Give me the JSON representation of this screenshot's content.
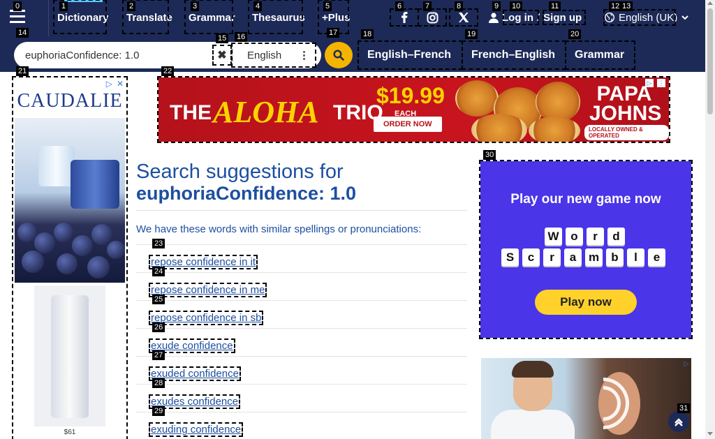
{
  "header": {
    "nav": [
      {
        "label": "Dictionary",
        "hint": "1"
      },
      {
        "label": "Translate",
        "hint": "2"
      },
      {
        "label": "Grammar",
        "hint": "3"
      },
      {
        "label": "Thesaurus",
        "hint": "4"
      },
      {
        "label": "+Plus",
        "hint": "5"
      }
    ],
    "menu_hint": "0",
    "social": [
      {
        "name": "facebook",
        "hint": "6"
      },
      {
        "name": "instagram",
        "hint": "7"
      },
      {
        "name": "x-twitter",
        "hint": "8"
      }
    ],
    "login": {
      "hint": "9",
      "login_label": "Log in",
      "separator": "/",
      "signup_label": "Sign up",
      "signup_hint": "10",
      "signup_hint2": "11"
    },
    "language": {
      "label": "English (UK)",
      "hint_a": "12",
      "hint_b": "13"
    }
  },
  "search": {
    "value": "euphoriaConfidence: 1.0",
    "hint": "14",
    "clear_hint": "15",
    "dictionary_select": "English",
    "select_hint": "16",
    "submit_hint": "17"
  },
  "dict_links": [
    {
      "label": "English–French",
      "hint": "18"
    },
    {
      "label": "French–English",
      "hint": "19"
    },
    {
      "label": "Grammar",
      "hint": "20"
    }
  ],
  "ads": {
    "left": {
      "hint": "21",
      "brand": "CAUDALIE",
      "price": "$61"
    },
    "banner": {
      "hint": "22",
      "the": "THE",
      "aloha": "ALOHA",
      "trio": "TRIO",
      "price": "$19.99",
      "each": "EACH",
      "order": "ORDER NOW",
      "brand_line1": "PAPA",
      "brand_line2": "JOHNS",
      "local": "LOCALLY OWNED & OPERATED"
    },
    "game": {
      "hint": "30",
      "title": "Play our new game now",
      "row1": [
        "W",
        "o",
        "r",
        "d"
      ],
      "row2": [
        "S",
        "c",
        "r",
        "a",
        "m",
        "b",
        "l",
        "e"
      ],
      "button": "Play now"
    }
  },
  "main": {
    "title_prefix": "Search suggestions for",
    "title_query": "euphoriaConfidence: 1.0",
    "intro": "We have these words with similar spellings or pronunciations:",
    "suggestions": [
      {
        "text": "repose confidence in it",
        "hint": "23"
      },
      {
        "text": "repose confidence in me",
        "hint": "24"
      },
      {
        "text": "repose confidence in sb",
        "hint": "25"
      },
      {
        "text": "exude confidence",
        "hint": "26"
      },
      {
        "text": "exuded confidence",
        "hint": "27"
      },
      {
        "text": "exudes confidence",
        "hint": "28"
      },
      {
        "text": "exuding confidence",
        "hint": "29"
      }
    ]
  },
  "scroll_top_hint": "31",
  "colors": {
    "header_bg": "#1d2a57",
    "accent_yellow": "#f4b400",
    "link_blue": "#1d4fa0",
    "game_purple": "#4a35e8"
  }
}
